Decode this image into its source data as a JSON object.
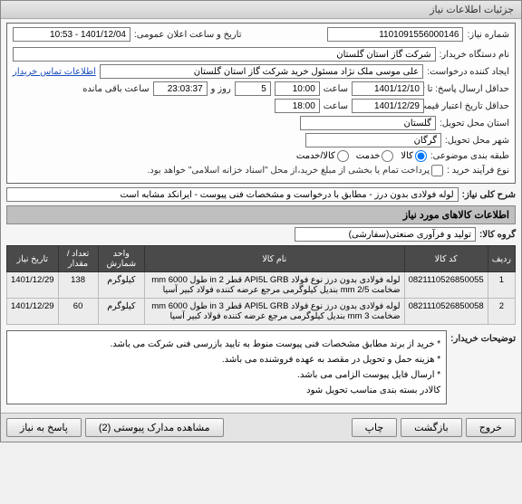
{
  "window": {
    "title": "جزئیات اطلاعات نیاز"
  },
  "labels": {
    "need_no": "شماره نیاز:",
    "pub_datetime": "تاریخ و ساعت اعلان عمومی:",
    "buyer_org": "نام دستگاه خریدار:",
    "requester": "ایجاد کننده درخواست:",
    "contact_link": "اطلاعات تماس خریدار",
    "deadline_from": "حداقل ارسال پاسخ: تا تاریخ:",
    "validity_until": "حداقل تاریخ اعتبار قیمت تا تاریخ:",
    "hour": "ساعت",
    "minutes": "روز و",
    "remain": "ساعت باقی مانده",
    "province": "استان محل تحویل:",
    "city": "شهر محل تحویل:",
    "category": "طبقه بندی موضوعی:",
    "goods": "کالا",
    "service": "خدمت",
    "goods_service": "کالا/خدمت",
    "buy_process": "نوع فرآیند خرید :",
    "buy_note": "پرداخت تمام یا بخشی از مبلغ خرید،از محل \"اسناد خزانه اسلامی\" خواهد بود.",
    "need_desc_lbl": "شرح کلی نیاز:",
    "goods_info_head": "اطلاعات کالاهای مورد نیاز",
    "goods_group_lbl": "گروه کالا:",
    "buyer_notes_lbl": "توضیحات خریدار:"
  },
  "fields": {
    "need_no": "1101091556000146",
    "pub_datetime": "1401/12/04 - 10:53",
    "buyer_org": "شرکت گاز استان گلستان",
    "requester": "علی موسی ملک نژاد مسئول خرید شرکت گاز استان گلستان",
    "deadline_date": "1401/12/10",
    "deadline_hour": "10:00",
    "deadline_days": "5",
    "deadline_remain": "23:03:37",
    "validity_date": "1401/12/29",
    "validity_hour": "18:00",
    "province": "گلستان",
    "city": "گرگان",
    "need_desc": "لوله فولادی بدون درز - مطابق با درخواست و مشخصات فنی پیوست - ایرانکد مشابه است",
    "goods_group": "تولید و فرآوری صنعتی(سفارشی)"
  },
  "table": {
    "headers": {
      "row": "ردیف",
      "code": "کد کالا",
      "name": "نام کالا",
      "unit": "واحد شمارش",
      "qty": "تعداد / مقدار",
      "date": "تاریخ نیاز"
    },
    "rows": [
      {
        "row": "1",
        "code": "0821110526850055",
        "name": "لوله فولادی بدون درز نوع فولاد API5L GRB قطر 2 in طول 6000 mm ضخامت 2/5 mm بندیل کیلوگرمی مرجع عرضه کننده فولاد کبیر آسیا",
        "unit": "کیلوگرم",
        "qty": "138",
        "date": "1401/12/29"
      },
      {
        "row": "2",
        "code": "0821110526850058",
        "name": "لوله فولادی بدون درز نوع فولاد API5L GRB قطر 3 in طول 6000 mm ضخامت 3 mm بندیل کیلوگرمی مرجع عرضه کننده فولاد کبیر آسیا",
        "unit": "کیلوگرم",
        "qty": "60",
        "date": "1401/12/29"
      }
    ]
  },
  "buyer_notes": "* خرید از برند مطابق مشخصات فنی پیوست منوط به تایید بازرسی فنی شرکت می باشد.\n* هزینه حمل و تحویل در مقصد به عهده فروشنده می باشد.\n* ارسال فایل پیوست الزامی می باشد.\nکالادر بسته بندی مناسب تحویل شود",
  "footer": {
    "reply": "پاسخ به نیاز",
    "view_docs": "مشاهده مدارک پیوستی",
    "view_docs_count": "(2)",
    "print": "چاپ",
    "back": "بازگشت",
    "exit": "خروج"
  }
}
